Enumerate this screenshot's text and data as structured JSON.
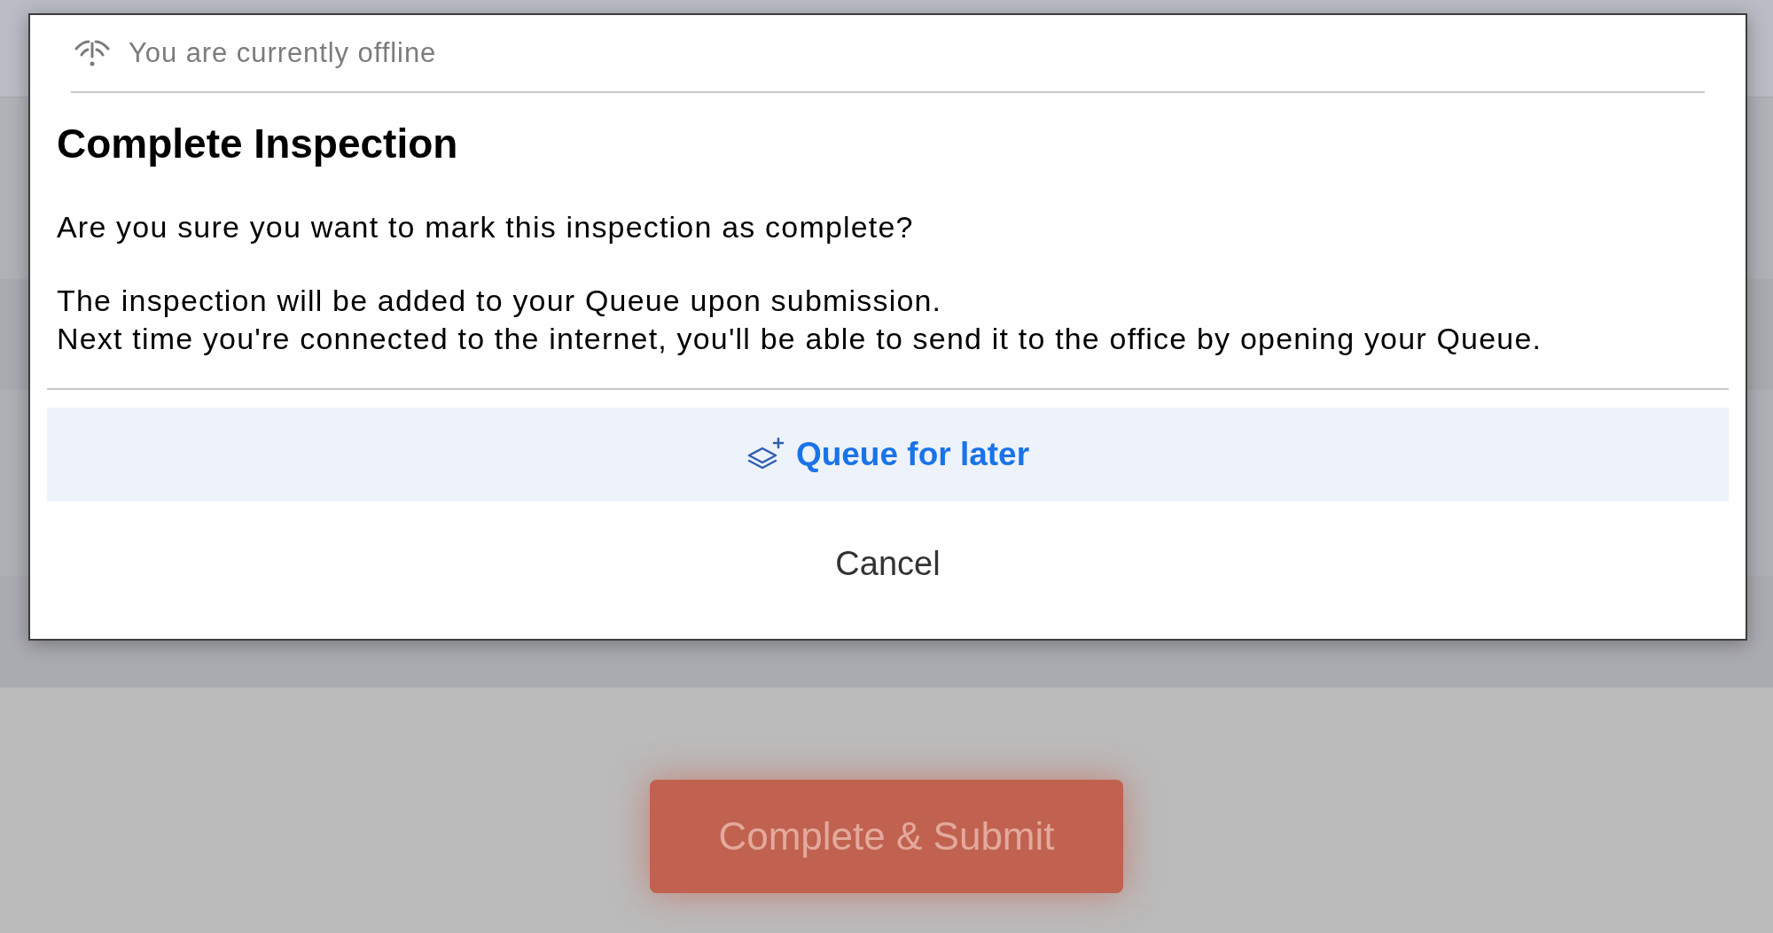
{
  "banner": {
    "text": "You are currently offline"
  },
  "dialog": {
    "title": "Complete Inspection",
    "paragraphs": [
      "Are you sure you want to mark this inspection as complete?",
      "The inspection will be added to your Queue upon submission.\nNext time you're connected to the internet, you'll be able to send it to the office by opening your Queue."
    ],
    "actions": [
      {
        "kind": "primary",
        "label": "Queue for later"
      },
      {
        "kind": "plain",
        "label": "Cancel"
      }
    ]
  },
  "page": {
    "submit_button": "Complete & Submit"
  }
}
